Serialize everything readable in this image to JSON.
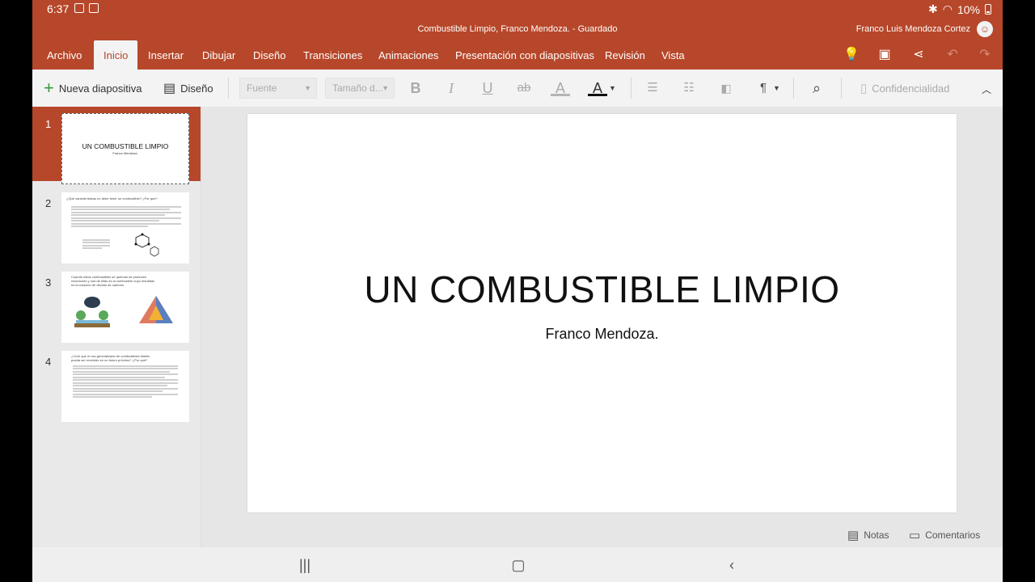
{
  "status": {
    "time": "6:37",
    "battery": "10%"
  },
  "window": {
    "title": "Combustible Limpio, Franco Mendoza. - Guardado",
    "user": "Franco Luis Mendoza Cortez"
  },
  "tabs": [
    "Archivo",
    "Inicio",
    "Insertar",
    "Dibujar",
    "Diseño",
    "Transiciones",
    "Animaciones",
    "Presentación con diapositivas",
    "Revisión",
    "Vista"
  ],
  "active_tab": "Inicio",
  "ribbon": {
    "new_slide": "Nueva diapositiva",
    "design": "Diseño",
    "font_placeholder": "Fuente",
    "size_placeholder": "Tamaño d...",
    "confidentiality": "Confidencialidad"
  },
  "thumbnails": [
    {
      "num": "1",
      "title": "UN COMBUSTIBLE LIMPIO",
      "subtitle": "Franco Mendoza."
    },
    {
      "num": "2",
      "heading": "¿Qué características no debe tener un combustible? ¿Por qué?"
    },
    {
      "num": "3",
      "heading": "Cuando estos combustibles se queman se producen reacciones y una de ellas es la combustión cuyo resultado es la creación de dióxido de carbono"
    },
    {
      "num": "4",
      "heading": "¿Cree que el uso generalizado de combustibles fósiles pueda ser revertido en un futuro próximo? ¿Por qué?"
    }
  ],
  "slide": {
    "title": "UN COMBUSTIBLE LIMPIO",
    "subtitle": "Franco Mendoza."
  },
  "footer": {
    "notes": "Notas",
    "comments": "Comentarios"
  },
  "colors": {
    "accent": "#b7472a"
  }
}
